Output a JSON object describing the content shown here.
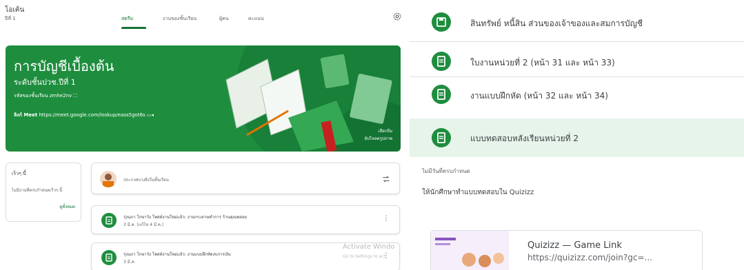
{
  "classroom": {
    "class_name": "โอเค้น",
    "class_sub": "ปีที่ 1",
    "tabs": [
      "สตรีม",
      "งานของชั้นเรียน",
      "ผู้คน",
      "คะแนน"
    ],
    "banner": {
      "title": "การบัญชีเบื้องต้น",
      "subtitle": "ระดับชั้นปวช.ปีที่ 1",
      "class_code_label": "รหัสของชั้นเรียน",
      "class_code": "zmhe2nv",
      "meet_label": "ลิงก์ Meet",
      "meet_url": "https://meet.google.com/lookup/eass5got6s",
      "select_theme": "เลือกธีม",
      "upload_photo": "อัปโหลดรูปภาพ"
    },
    "upcoming": {
      "title": "เร็วๆ นี้",
      "empty": "ไม่มีงานที่ครบกำหนดเร็วๆ นี้",
      "view_all": "ดูทั้งหมด"
    },
    "announce_placeholder": "ประกาศบางสิ่งในชั้นเรียน",
    "posts": [
      {
        "title": "รุ่งนภา โกษาวัง โพสต์งานใหม่แล้ว: งานกระดาษทำการ ร้านคุณพลอย",
        "date": "3 มี.ค. (แก้ไข 4 มี.ค.)"
      },
      {
        "title": "รุ่งนภา โกษาวัง โพสต์งานใหม่แล้ว: งานแบบฝึกหัดงบการเงิน",
        "date": "3 มี.ค."
      }
    ],
    "activate": {
      "title": "Activate Windo",
      "sub": "Go to Settings to act"
    }
  },
  "assignments": {
    "items": [
      {
        "label": "สินทรัพย์ หนี้สิน ส่วนของเจ้าของและสมการบัญชี"
      },
      {
        "label": "ใบงานหน่วยที่ 2 (หน้า 31 และ หน้า 33)"
      },
      {
        "label": "งานแบบฝึกหัด (หน้า 32 และ หน้า 34)"
      },
      {
        "label": "แบบทดสอบหลังเรียนหน่วยที่ 2"
      }
    ],
    "no_due": "ไม่มีวันที่ครบกำหนด",
    "instruction": "ให้นักศึกษาทำแบบทดสอบใน Quizizz",
    "link": {
      "title": "Quizizz — Game Link",
      "url": "https://quizizz.com/join?gc=..."
    }
  },
  "colors": {
    "accent": "#1e8e3e",
    "highlight": "#e6f4ea"
  }
}
